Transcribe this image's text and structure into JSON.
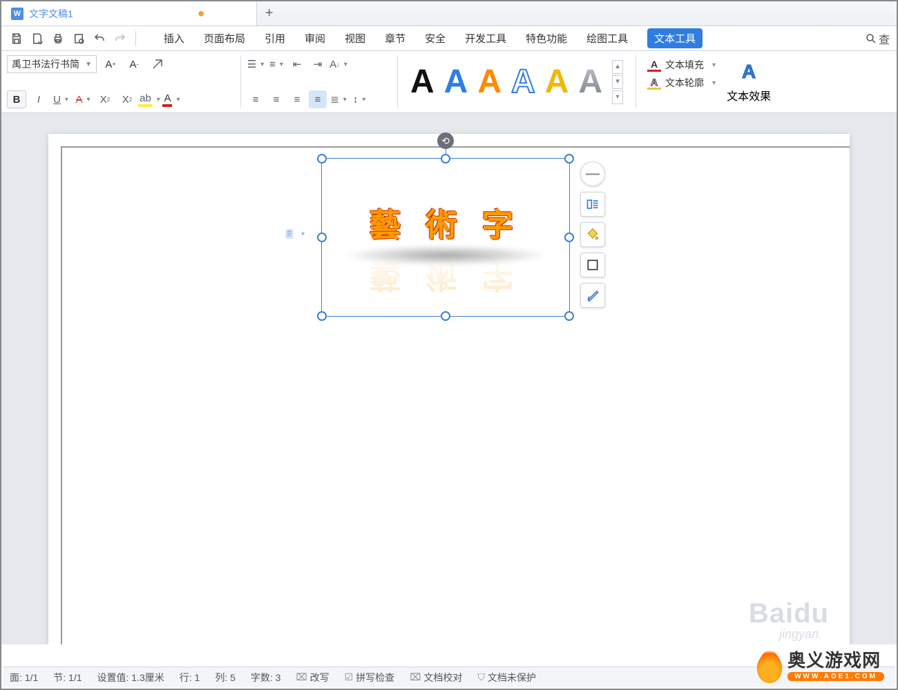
{
  "tab": {
    "title": "文字文稿1",
    "modified_indicator": "●",
    "doc_icon": "W"
  },
  "menubar": {
    "items": [
      "插入",
      "页面布局",
      "引用",
      "审阅",
      "视图",
      "章节",
      "安全",
      "开发工具",
      "特色功能",
      "绘图工具",
      "文本工具"
    ],
    "active_index": 10,
    "search_label": "查"
  },
  "ribbon": {
    "font_name": "禹卫书法行书简",
    "text_fill": "文本填充",
    "text_outline": "文本轮廓",
    "text_effects": "文本效果",
    "style_colors": [
      "#111111",
      "#2f7de1",
      "#ff8a00",
      "#2f7de1",
      "#f2b705",
      "#9a9fa7"
    ]
  },
  "document": {
    "wordart_text": "藝 術 字",
    "anchor_glyph": "📄"
  },
  "side_panel": {
    "collapse": "—",
    "wrap_icon": "wrap",
    "fill_icon": "fill",
    "border_icon": "border",
    "format_icon": "brush"
  },
  "watermark": {
    "main": "Baidu",
    "sub": "jingyan."
  },
  "statusbar": {
    "page": "面: 1/1",
    "section": "节: 1/1",
    "setvalue": "设置值: 1.3厘米",
    "line": "行: 1",
    "col": "列: 5",
    "chars": "字数: 3",
    "overwrite": "改写",
    "spell": "拼写检查",
    "proof": "文档校对",
    "protect": "文档未保护"
  },
  "brand": {
    "cn": "奥义游戏网",
    "en": "WWW.AOE1.COM"
  }
}
